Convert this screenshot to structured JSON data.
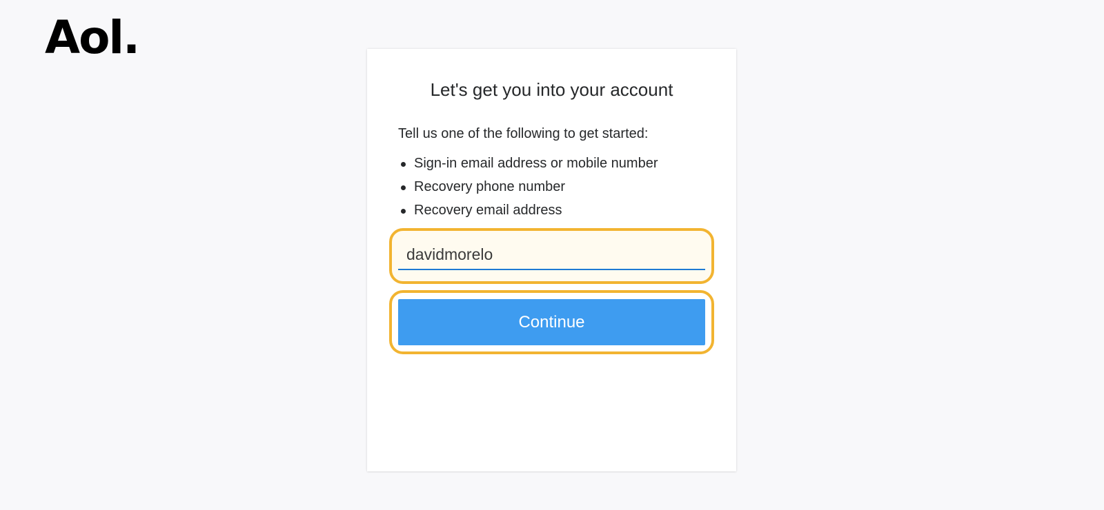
{
  "brand": {
    "logo_text": "Aol."
  },
  "recovery": {
    "title": "Let's get you into your account",
    "intro": "Tell us one of the following to get started:",
    "options": [
      "Sign-in email address or mobile number",
      "Recovery phone number",
      "Recovery email address"
    ],
    "input_value": "davidmorelo",
    "continue_label": "Continue"
  },
  "colors": {
    "background": "#f8f8fa",
    "card": "#ffffff",
    "primary_button": "#3e9cf0",
    "input_underline": "#1d7ad4",
    "highlight_outline": "#f2b431"
  }
}
